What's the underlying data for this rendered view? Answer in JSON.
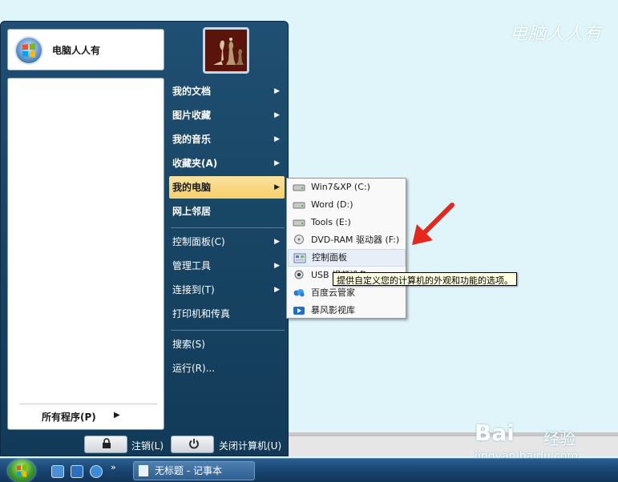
{
  "watermark": {
    "top_text": "电脑人人有",
    "baidu_logo": "Bai",
    "baidu_sub": "经验",
    "baidu_url": "jingyan.baidu.com"
  },
  "start_menu": {
    "user_name": "电脑人人有",
    "all_programs": "所有程序(P)",
    "right_items": [
      {
        "label": "我的文档",
        "bold": true,
        "submenu": true
      },
      {
        "label": "图片收藏",
        "bold": true,
        "submenu": true
      },
      {
        "label": "我的音乐",
        "bold": true,
        "submenu": true
      },
      {
        "label": "收藏夹(A)",
        "bold": true,
        "submenu": true
      },
      {
        "label": "我的电脑",
        "bold": true,
        "submenu": true,
        "active": true
      },
      {
        "label": "网上邻居",
        "bold": true,
        "submenu": false
      },
      {
        "label": "控制面板(C)",
        "bold": false,
        "submenu": true
      },
      {
        "label": "管理工具",
        "bold": false,
        "submenu": true
      },
      {
        "label": "连接到(T)",
        "bold": false,
        "submenu": true
      },
      {
        "label": "打印机和传真",
        "bold": false,
        "submenu": false
      },
      {
        "label": "搜索(S)",
        "bold": false,
        "submenu": false
      },
      {
        "label": "运行(R)...",
        "bold": false,
        "submenu": false
      }
    ],
    "logoff_label": "注销(L)",
    "shutdown_label": "关闭计算机(U)"
  },
  "submenu": {
    "items": [
      {
        "label": "Win7&XP (C:)",
        "icon": "hard-drive-icon"
      },
      {
        "label": "Word (D:)",
        "icon": "hard-drive-icon"
      },
      {
        "label": "Tools (E:)",
        "icon": "hard-drive-icon"
      },
      {
        "label": "DVD-RAM 驱动器 (F:)",
        "icon": "dvd-drive-icon"
      },
      {
        "label": "控制面板",
        "icon": "control-panel-icon",
        "hover": true
      },
      {
        "label": "USB 视频设备",
        "icon": "usb-camera-icon"
      },
      {
        "label": "百度云管家",
        "icon": "baidu-cloud-icon"
      },
      {
        "label": "暴风影视库",
        "icon": "video-library-icon"
      }
    ]
  },
  "tooltip": "提供自定义您的计算机的外观和功能的选项。",
  "taskbar": {
    "task_label": "无标题 - 记事本",
    "more": "»"
  },
  "colors": {
    "menu_bg": "#1a4a6b",
    "active_item": "#f6cf6a",
    "arrow": "#e8261c"
  }
}
